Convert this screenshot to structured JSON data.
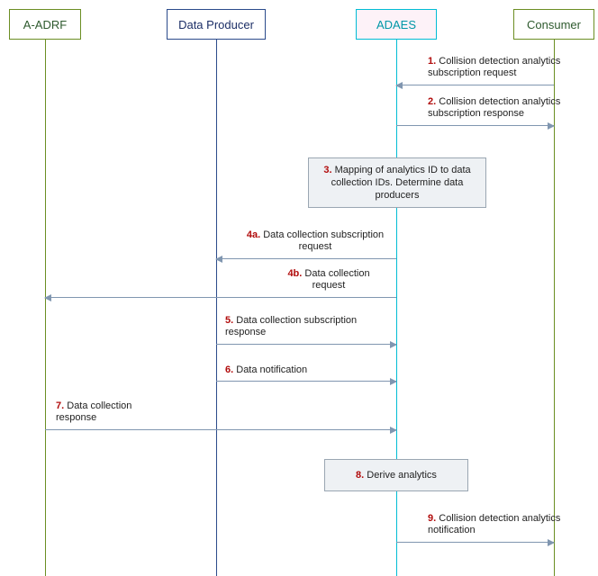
{
  "actors": {
    "aadrf": "A-ADRF",
    "dp": "Data Producer",
    "adaes": "ADAES",
    "consumer": "Consumer"
  },
  "messages": {
    "m1": {
      "num": "1.",
      "text": "Collision detection analytics subscription request"
    },
    "m2": {
      "num": "2.",
      "text": "Collision detection analytics subscription response"
    },
    "n3": {
      "num": "3.",
      "text": "Mapping of analytics ID to data collection IDs. Determine data producers"
    },
    "m4a": {
      "num": "4a.",
      "text": "Data collection subscription request"
    },
    "m4b": {
      "num": "4b.",
      "text": "Data collection request"
    },
    "m5": {
      "num": "5.",
      "text": "Data collection subscription response"
    },
    "m6": {
      "num": "6.",
      "text": "Data notification"
    },
    "m7": {
      "num": "7.",
      "text": "Data collection response"
    },
    "n8": {
      "num": "8.",
      "text": "Derive analytics"
    },
    "m9": {
      "num": "9.",
      "text": "Collision detection analytics notification"
    }
  }
}
